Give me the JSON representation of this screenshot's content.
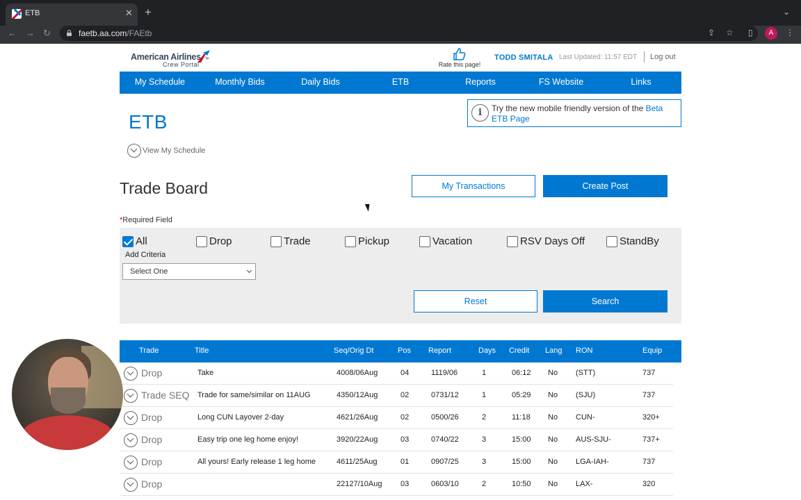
{
  "browser": {
    "tab_title": "ETB",
    "url_host": "faetb.aa.com",
    "url_path": "/FAEtb",
    "profile_initial": "A"
  },
  "header": {
    "brand": "American Airlines",
    "brand_sub": "Crew Portal",
    "rate_label": "Rate this page!",
    "user_name": "TODD SMITALA",
    "last_updated": "Last Updated: 11:57 EDT",
    "logout": "Log out"
  },
  "nav": [
    {
      "label": "My Schedule"
    },
    {
      "label": "Monthly Bids"
    },
    {
      "label": "Daily Bids"
    },
    {
      "label": "ETB"
    },
    {
      "label": "Reports"
    },
    {
      "label": "FS Website"
    },
    {
      "label": "Links"
    }
  ],
  "banner": {
    "text": "Try the new mobile friendly version of the ",
    "link": "Beta ETB Page"
  },
  "page": {
    "title": "ETB",
    "view_schedule": "View My Schedule",
    "board_title": "Trade Board",
    "my_transactions": "My Transactions",
    "create_post": "Create Post",
    "required_star": "*",
    "required_label": "Required Field"
  },
  "filters": {
    "checkboxes": [
      {
        "label": "All",
        "checked": true
      },
      {
        "label": "Drop",
        "checked": false
      },
      {
        "label": "Trade",
        "checked": false
      },
      {
        "label": "Pickup",
        "checked": false
      },
      {
        "label": "Vacation",
        "checked": false
      },
      {
        "label": "RSV Days Off",
        "checked": false
      },
      {
        "label": "StandBy",
        "checked": false
      }
    ],
    "add_criteria_label": "Add Criteria",
    "select_value": "Select One",
    "reset": "Reset",
    "search": "Search"
  },
  "table": {
    "columns": [
      "Trade",
      "Title",
      "Seq/Orig Dt",
      "Pos",
      "Report",
      "Days",
      "Credit",
      "Lang",
      "RON",
      "Equip"
    ],
    "rows": [
      [
        "Drop",
        "Take",
        "4008/06Aug",
        "04",
        "1119/06",
        "1",
        "06:12",
        "No",
        "(STT)",
        "737"
      ],
      [
        "Trade SEQ",
        "Trade for same/similar on 11AUG",
        "4350/12Aug",
        "02",
        "0731/12",
        "1",
        "05:29",
        "No",
        "(SJU)",
        "737"
      ],
      [
        "Drop",
        "Long CUN Layover 2-day",
        "4621/26Aug",
        "02",
        "0500/26",
        "2",
        "11:18",
        "No",
        "CUN-",
        "320+"
      ],
      [
        "Drop",
        "Easy trip one leg home enjoy!",
        "3920/22Aug",
        "03",
        "0740/22",
        "3",
        "15:00",
        "No",
        "AUS-SJU-",
        "737+"
      ],
      [
        "Drop",
        "All yours! Early release 1 leg home",
        "4611/25Aug",
        "01",
        "0907/25",
        "3",
        "15:00",
        "No",
        "LGA-IAH-",
        "737"
      ],
      [
        "Drop",
        "",
        "22127/10Aug",
        "03",
        "0603/10",
        "2",
        "10:50",
        "No",
        "LAX-",
        "320"
      ]
    ]
  },
  "colors": {
    "aa_blue": "#0078d2",
    "panel_gray": "#ededed",
    "chrome_dark": "#202124"
  }
}
